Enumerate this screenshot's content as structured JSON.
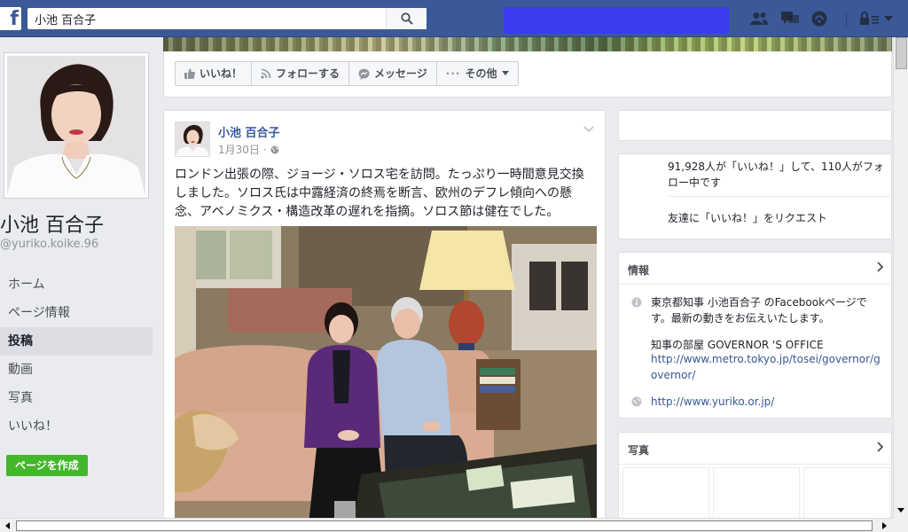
{
  "topbar": {
    "logo": "f",
    "search_value": "小池 百合子",
    "icons": [
      "friends-icon",
      "messages-icon",
      "notifications-icon",
      "privacy-icon",
      "menu-icon"
    ]
  },
  "sidebar": {
    "name": "小池 百合子",
    "username": "@yuriko.koike.96",
    "items": [
      {
        "label": "ホーム"
      },
      {
        "label": "ページ情報"
      },
      {
        "label": "投稿"
      },
      {
        "label": "動画"
      },
      {
        "label": "写真"
      },
      {
        "label": "いいね！"
      }
    ],
    "create_page": "ページを作成"
  },
  "actions": {
    "like": "いいね！",
    "follow": "フォローする",
    "message": "メッセージ",
    "more": "その他"
  },
  "post": {
    "author": "小池 百合子",
    "date": "1月30日",
    "text": "ロンドン出張の際、ジョージ・ソロス宅を訪問。たっぷり一時間意見交換しました。ソロス氏は中露経済の終焉を断言、欧州のデフレ傾向への懸念、アベノミクス・構造改革の遅れを指摘。ソロス節は健在でした。"
  },
  "right": {
    "likes_text": "91,928人が「いいね！」して、110人がフォロー中です",
    "invite_text": "友達に「いいね！」をリクエスト",
    "about": {
      "title": "情報",
      "description": "東京都知事 小池百合子 のFacebookページです。最新の動きをお伝えいたします。",
      "office_label": "知事の部屋 GOVERNOR 'S OFFICE",
      "office_url": "http://www.metro.tokyo.jp/tosei/governor/governor/",
      "website": "http://www.yuriko.or.jp/"
    },
    "photos": {
      "title": "写真"
    }
  },
  "colors": {
    "brand": "#3b5998",
    "link": "#365899",
    "green": "#42b72a",
    "redacted": "#3b3bf0"
  }
}
